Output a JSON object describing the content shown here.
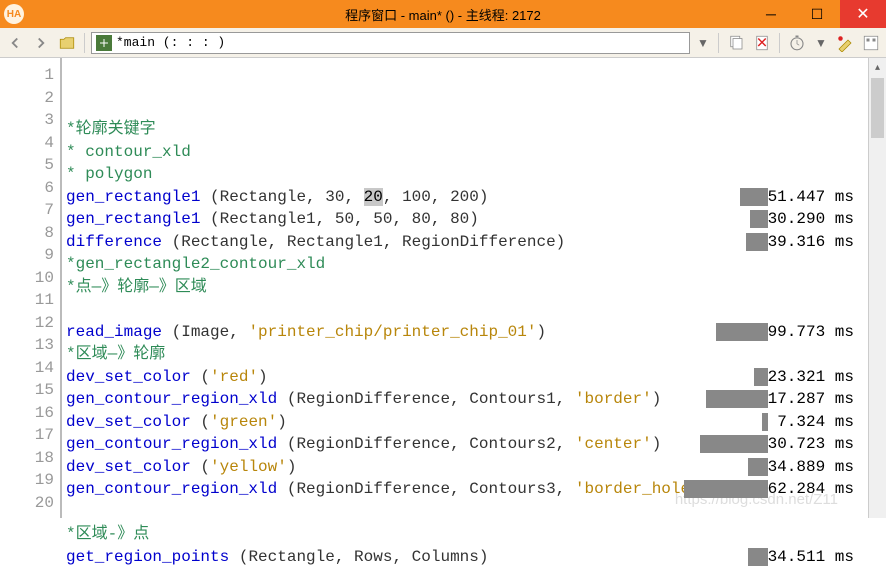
{
  "title": "程序窗口 - main* () - 主线程: 2172",
  "titlebar_icon": "HA",
  "path_combo": "*main (: : : )",
  "toolbar": {
    "back": "←",
    "forward": "→",
    "open": "open",
    "dropdown": "▼",
    "copy": "copy",
    "delete": "del",
    "timer": "timer",
    "tools1": "t1",
    "tools2": "t2"
  },
  "lines": [
    {
      "n": 1,
      "seg": [
        [
          "cmt",
          "*轮廓关键字"
        ]
      ]
    },
    {
      "n": 2,
      "seg": [
        [
          "cmt",
          "* contour_xld"
        ]
      ]
    },
    {
      "n": 3,
      "seg": [
        [
          "cmt",
          "* polygon"
        ]
      ]
    },
    {
      "n": 4,
      "seg": [
        [
          "op",
          "gen_rectangle1"
        ],
        [
          "paren",
          " (Rectangle, 30, "
        ],
        [
          "sel",
          "20"
        ],
        [
          "paren",
          ", 100, 200)"
        ]
      ],
      "time": "51.447 ms",
      "bar": 28
    },
    {
      "n": 5,
      "seg": [
        [
          "op",
          "gen_rectangle1"
        ],
        [
          "paren",
          " (Rectangle1, 50, 50, 80, 80)"
        ]
      ],
      "time": "30.290 ms",
      "bar": 18
    },
    {
      "n": 6,
      "seg": [
        [
          "op",
          "difference"
        ],
        [
          "paren",
          " (Rectangle, Rectangle1, RegionDifference)"
        ]
      ],
      "time": "39.316 ms",
      "bar": 22
    },
    {
      "n": 7,
      "seg": [
        [
          "cmt",
          "*gen_rectangle2_contour_xld"
        ]
      ]
    },
    {
      "n": 8,
      "seg": [
        [
          "cmt",
          "*点—》轮廓—》区域"
        ]
      ]
    },
    {
      "n": 9,
      "seg": []
    },
    {
      "n": 10,
      "seg": [
        [
          "op",
          "read_image"
        ],
        [
          "paren",
          " (Image, "
        ],
        [
          "str",
          "'printer_chip/printer_chip_01'"
        ],
        [
          "paren",
          ")"
        ]
      ],
      "time": "99.773 ms",
      "bar": 52
    },
    {
      "n": 11,
      "seg": [
        [
          "cmt",
          "*区域—》轮廓"
        ]
      ]
    },
    {
      "n": 12,
      "seg": [
        [
          "op",
          "dev_set_color"
        ],
        [
          "paren",
          " ("
        ],
        [
          "str",
          "'red'"
        ],
        [
          "paren",
          ")"
        ]
      ],
      "time": "23.321 ms",
      "bar": 14
    },
    {
      "n": 13,
      "seg": [
        [
          "op",
          "gen_contour_region_xld"
        ],
        [
          "paren",
          " (RegionDifference, Contours1, "
        ],
        [
          "str",
          "'border'"
        ],
        [
          "paren",
          ")"
        ]
      ],
      "time": "117.287 ms",
      "bar": 62
    },
    {
      "n": 14,
      "seg": [
        [
          "op",
          "dev_set_color"
        ],
        [
          "paren",
          " ("
        ],
        [
          "str",
          "'green'"
        ],
        [
          "paren",
          ")"
        ]
      ],
      "time": "7.324 ms",
      "bar": 6
    },
    {
      "n": 15,
      "seg": [
        [
          "op",
          "gen_contour_region_xld"
        ],
        [
          "paren",
          " (RegionDifference, Contours2, "
        ],
        [
          "str",
          "'center'"
        ],
        [
          "paren",
          ")"
        ]
      ],
      "time": "130.723 ms",
      "bar": 68
    },
    {
      "n": 16,
      "seg": [
        [
          "op",
          "dev_set_color"
        ],
        [
          "paren",
          " ("
        ],
        [
          "str",
          "'yellow'"
        ],
        [
          "paren",
          ")"
        ]
      ],
      "time": "34.889 ms",
      "bar": 20
    },
    {
      "n": 17,
      "seg": [
        [
          "op",
          "gen_contour_region_xld"
        ],
        [
          "paren",
          " (RegionDifference, Contours3, "
        ],
        [
          "str",
          "'border_holes'"
        ]
      ],
      "time": "162.284 ms",
      "bar": 84
    },
    {
      "n": 18,
      "seg": []
    },
    {
      "n": 19,
      "seg": [
        [
          "cmt",
          "*区域-》点"
        ]
      ]
    },
    {
      "n": 20,
      "seg": [
        [
          "op",
          "get_region_points"
        ],
        [
          "paren",
          " (Rectangle, Rows, Columns)"
        ]
      ],
      "time": "34.511 ms",
      "bar": 20
    }
  ],
  "watermark": "https://blog.csdn.net/Z11"
}
